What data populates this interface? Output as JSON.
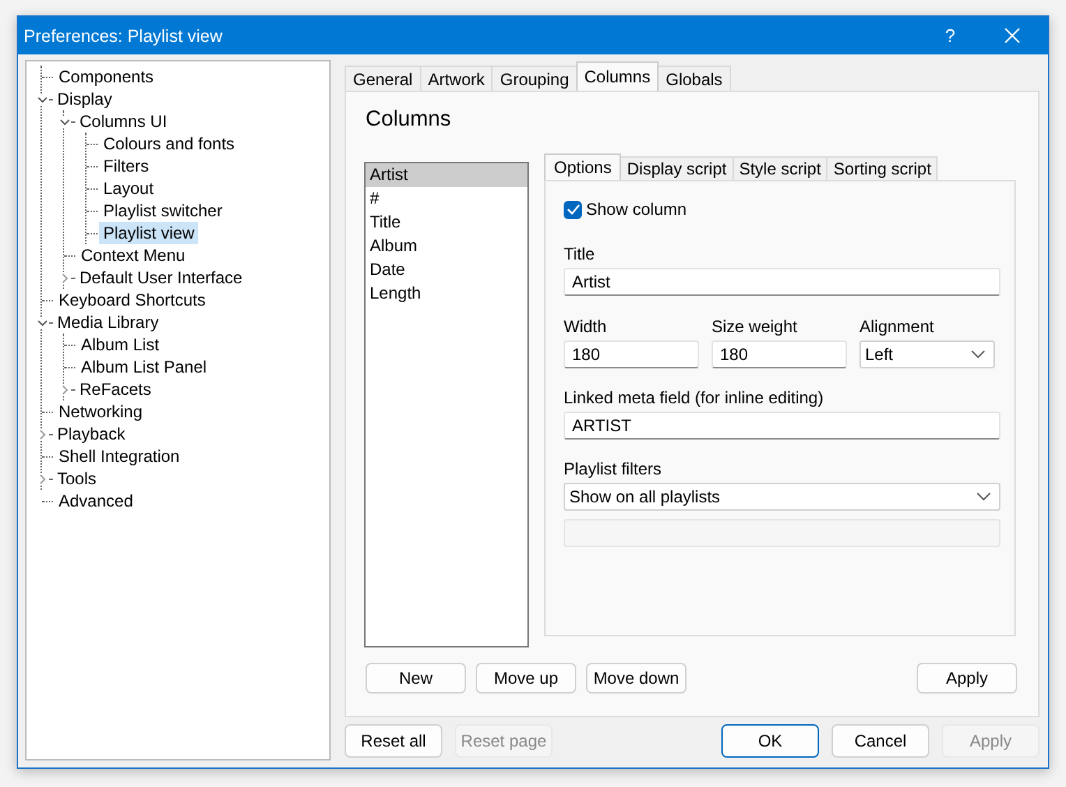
{
  "window": {
    "title": "Preferences: Playlist view",
    "help": "?"
  },
  "tree": [
    {
      "label": "Components",
      "selected": false
    },
    {
      "label": "Display",
      "selected": false,
      "expanded": true,
      "children": [
        {
          "label": "Columns UI",
          "selected": false,
          "expanded": true,
          "children": [
            {
              "label": "Colours and fonts",
              "selected": false
            },
            {
              "label": "Filters",
              "selected": false
            },
            {
              "label": "Layout",
              "selected": false
            },
            {
              "label": "Playlist switcher",
              "selected": false
            },
            {
              "label": "Playlist view",
              "selected": true
            }
          ]
        },
        {
          "label": "Context Menu",
          "selected": false
        },
        {
          "label": "Default User Interface",
          "selected": false,
          "expanded": false
        }
      ]
    },
    {
      "label": "Keyboard Shortcuts",
      "selected": false
    },
    {
      "label": "Media Library",
      "selected": false,
      "expanded": true,
      "children": [
        {
          "label": "Album List",
          "selected": false
        },
        {
          "label": "Album List Panel",
          "selected": false
        },
        {
          "label": "ReFacets",
          "selected": false,
          "expanded": false
        }
      ]
    },
    {
      "label": "Networking",
      "selected": false
    },
    {
      "label": "Playback",
      "selected": false,
      "expanded": false
    },
    {
      "label": "Shell Integration",
      "selected": false
    },
    {
      "label": "Tools",
      "selected": false,
      "expanded": false
    },
    {
      "label": "Advanced",
      "selected": false
    }
  ],
  "tabs": [
    {
      "label": "General",
      "selected": false
    },
    {
      "label": "Artwork",
      "selected": false
    },
    {
      "label": "Grouping",
      "selected": false
    },
    {
      "label": "Columns",
      "selected": true
    },
    {
      "label": "Globals",
      "selected": false
    }
  ],
  "page": {
    "heading": "Columns",
    "columns": [
      {
        "label": "Artist",
        "selected": true
      },
      {
        "label": "#",
        "selected": false
      },
      {
        "label": "Title",
        "selected": false
      },
      {
        "label": "Album",
        "selected": false
      },
      {
        "label": "Date",
        "selected": false
      },
      {
        "label": "Length",
        "selected": false
      }
    ],
    "inner_tabs": [
      {
        "label": "Options",
        "selected": true
      },
      {
        "label": "Display script",
        "selected": false
      },
      {
        "label": "Style script",
        "selected": false
      },
      {
        "label": "Sorting script",
        "selected": false
      }
    ],
    "show_column": {
      "label": "Show column",
      "checked": true
    },
    "title": {
      "label": "Title",
      "value": "Artist"
    },
    "width": {
      "label": "Width",
      "value": "180"
    },
    "size_weight": {
      "label": "Size weight",
      "value": "180"
    },
    "alignment": {
      "label": "Alignment",
      "value": "Left"
    },
    "linked_meta": {
      "label": "Linked meta field (for inline editing)",
      "value": "ARTIST"
    },
    "playlist_filters": {
      "label": "Playlist filters",
      "value": "Show on all playlists"
    },
    "list_buttons": [
      "New",
      "Move up",
      "Move down"
    ],
    "apply": "Apply"
  },
  "footer_left": [
    {
      "label": "Reset all",
      "disabled": false
    },
    {
      "label": "Reset page",
      "disabled": true
    }
  ],
  "footer_right": [
    {
      "label": "OK",
      "disabled": false,
      "default": true
    },
    {
      "label": "Cancel",
      "disabled": false,
      "default": false
    },
    {
      "label": "Apply",
      "disabled": true,
      "default": false
    }
  ]
}
